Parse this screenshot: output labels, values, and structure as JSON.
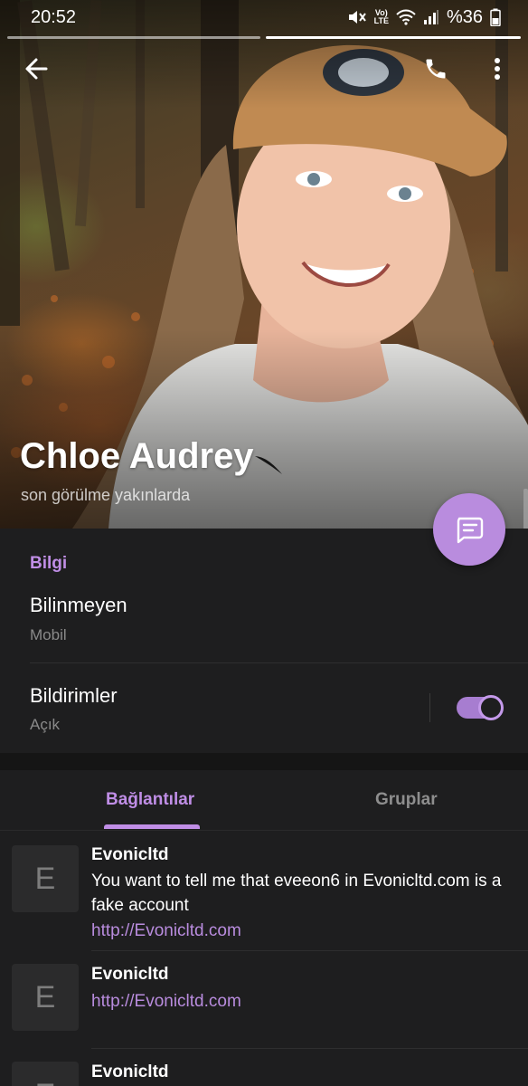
{
  "status_bar": {
    "time": "20:52",
    "volte_top": "Vo)",
    "volte_bottom": "LTE",
    "battery": "%36"
  },
  "profile": {
    "name": "Chloe Audrey",
    "status": "son görülme yakınlarda"
  },
  "icons": {
    "back": "arrow-left-icon",
    "call": "phone-icon",
    "more": "more-vertical-icon",
    "message": "message-icon"
  },
  "info": {
    "section_title": "Bilgi",
    "phone": {
      "title": "Bilinmeyen",
      "subtitle": "Mobil"
    },
    "notifications": {
      "title": "Bildirimler",
      "subtitle": "Açık",
      "enabled": true
    }
  },
  "tabs": [
    {
      "label": "Bağlantılar",
      "active": true
    },
    {
      "label": "Gruplar",
      "active": false
    }
  ],
  "links": [
    {
      "thumb": "E",
      "title": "Evonicltd",
      "description": "You want to tell me that eveeon6 in Evonicltd.com is a fake account",
      "url": "http://Evonicltd.com"
    },
    {
      "thumb": "E",
      "title": "Evonicltd",
      "url": "http://Evonicltd.com"
    },
    {
      "thumb": "E",
      "title": "Evonicltd"
    }
  ],
  "colors": {
    "accent": "#c08ee6",
    "fab": "#b98cde",
    "card": "#1e1e1f",
    "background": "#151515"
  }
}
